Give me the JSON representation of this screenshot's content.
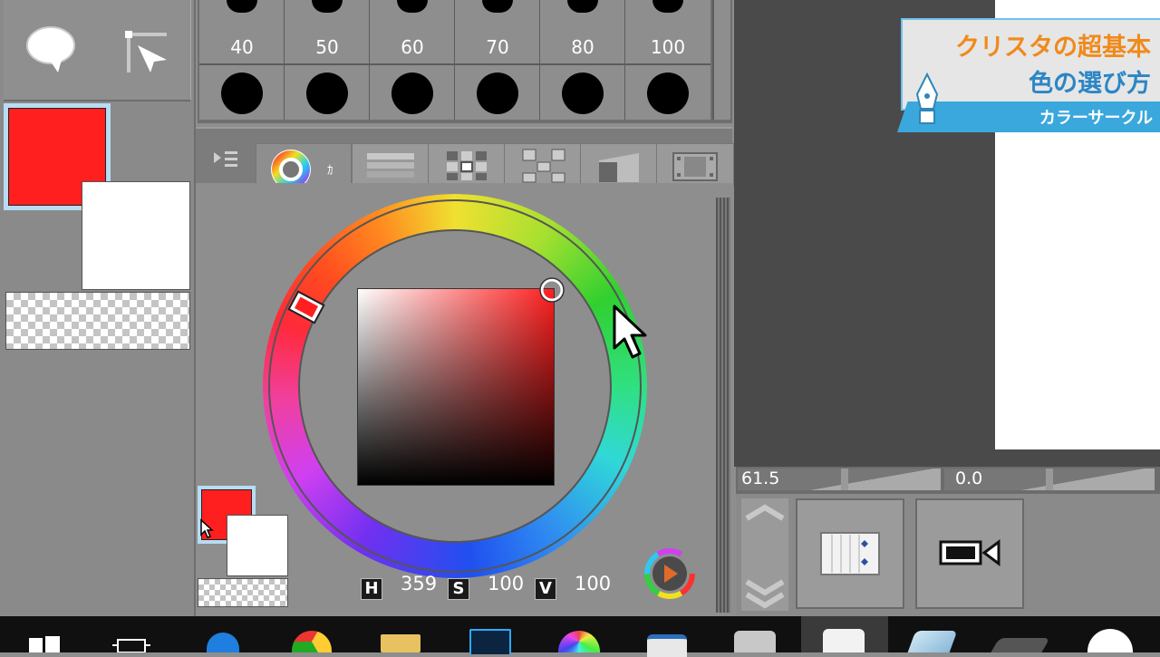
{
  "brush_sizes": {
    "labels": [
      "40",
      "50",
      "60",
      "70",
      "80",
      "100"
    ]
  },
  "color_circle": {
    "h_label": "H",
    "s_label": "S",
    "v_label": "V",
    "h_value": "359",
    "s_value": "100",
    "v_value": "100",
    "tab_marker": "ｶ"
  },
  "colors": {
    "main": "#ff1f1f",
    "sub": "#ffffff",
    "accent_caption": "#f08a1c",
    "caption_band": "#3aa8dc"
  },
  "canvas_readout": {
    "left_value": "61.5",
    "right_value": "0.0"
  },
  "caption": {
    "line1": "クリスタの超基本",
    "line2": "色の選び方",
    "band": "カラーサークル"
  },
  "taskbar": {
    "apps": [
      "windows-start-icon",
      "task-view-icon",
      "edge-icon",
      "chrome-icon",
      "file-explorer-icon",
      "photoshop-icon",
      "color-app-icon",
      "window-icon",
      "swirl-app-icon",
      "clip-studio-icon",
      "eraser-app-icon",
      "tablet-app-icon",
      "messenger-icon"
    ]
  }
}
